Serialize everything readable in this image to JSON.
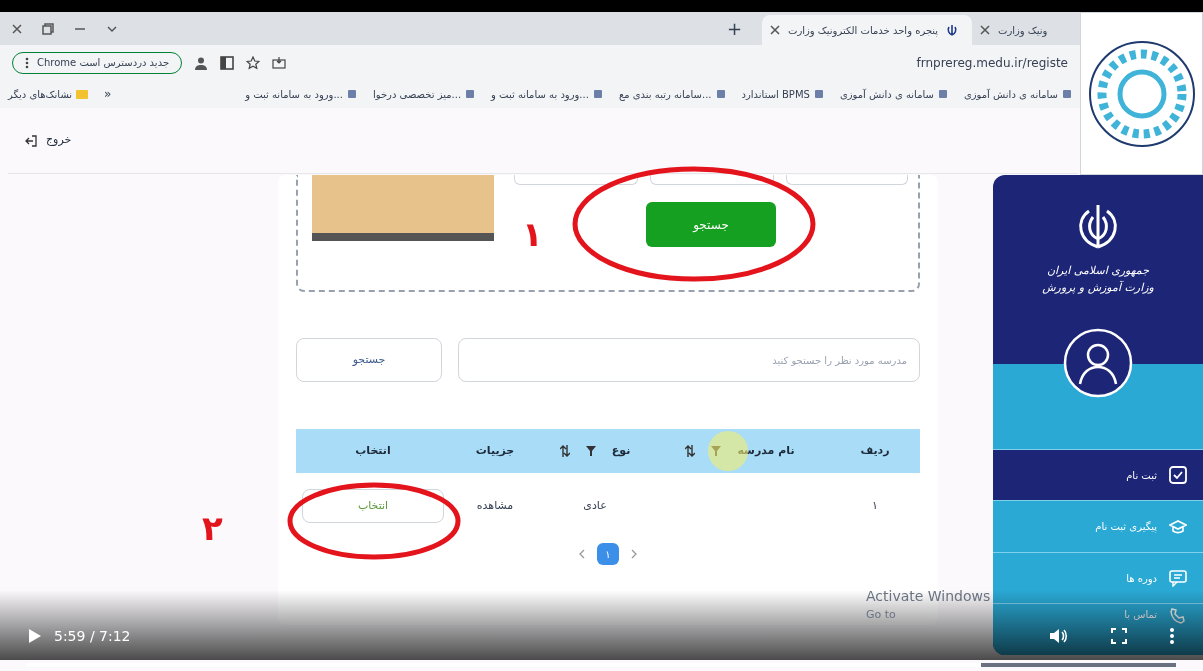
{
  "browser": {
    "tabs": [
      {
        "title": "ونیک وزارت",
        "selected": false
      },
      {
        "title": "پنجره واحد خدمات الکترونیک وزارت",
        "selected": true
      }
    ],
    "new_tab": "+",
    "address": "frnprereg.medu.ir/registe",
    "update_pill": "Chrome جدید دردسترس است",
    "bookmarks": [
      "سامانه ی دانش آموزی",
      "سامانه ی دانش آموزی",
      "استاندارد BPMS",
      "سامانه رتبه بندی مع...",
      "ورود به سامانه ثبت و...",
      "میز تخصصی درخوا...",
      "ورود به سامانه ثبت و..."
    ],
    "bookmarks_more": "»",
    "other_bookmarks": "نشانک‌های دیگر"
  },
  "header": {
    "logout": "خروج"
  },
  "search_form": {
    "submit": "جستجو",
    "note": "۱"
  },
  "school_search": {
    "placeholder": "مدرسه مورد نظر را جستجو کنید",
    "button": "جستجو"
  },
  "table": {
    "columns": [
      {
        "label": "ردیف",
        "kind": "plain"
      },
      {
        "label": "نام مدرسه",
        "kind": "filter"
      },
      {
        "label": "نوع",
        "kind": "filter"
      },
      {
        "label": "جزییات",
        "kind": "plain"
      },
      {
        "label": "انتخاب",
        "kind": "plain"
      }
    ],
    "rows": [
      {
        "index": "۱",
        "type": "عادی",
        "details": "مشاهده",
        "select": "انتخاب"
      }
    ],
    "note": "۲"
  },
  "pagination": {
    "pages": [
      {
        "label": "۱",
        "selected": true
      }
    ]
  },
  "sidebar": {
    "title_1": "جمهوری اسلامی ایران",
    "title_2": "وزارت آموزش و پرورش",
    "items": [
      {
        "label": "ثبت نام",
        "kind": "check",
        "selected": true
      },
      {
        "label": "پیگیری ثبت نام",
        "kind": "cap",
        "selected": false
      },
      {
        "label": "دوره ها",
        "kind": "chat",
        "selected": false
      },
      {
        "label": "تماس با",
        "kind": "phone",
        "selected": false
      }
    ]
  },
  "os_notice": {
    "line_1": "Activate Windows",
    "line_2": "Go to"
  },
  "player": {
    "time": "5:59 / 7:12",
    "level": 0.83
  }
}
